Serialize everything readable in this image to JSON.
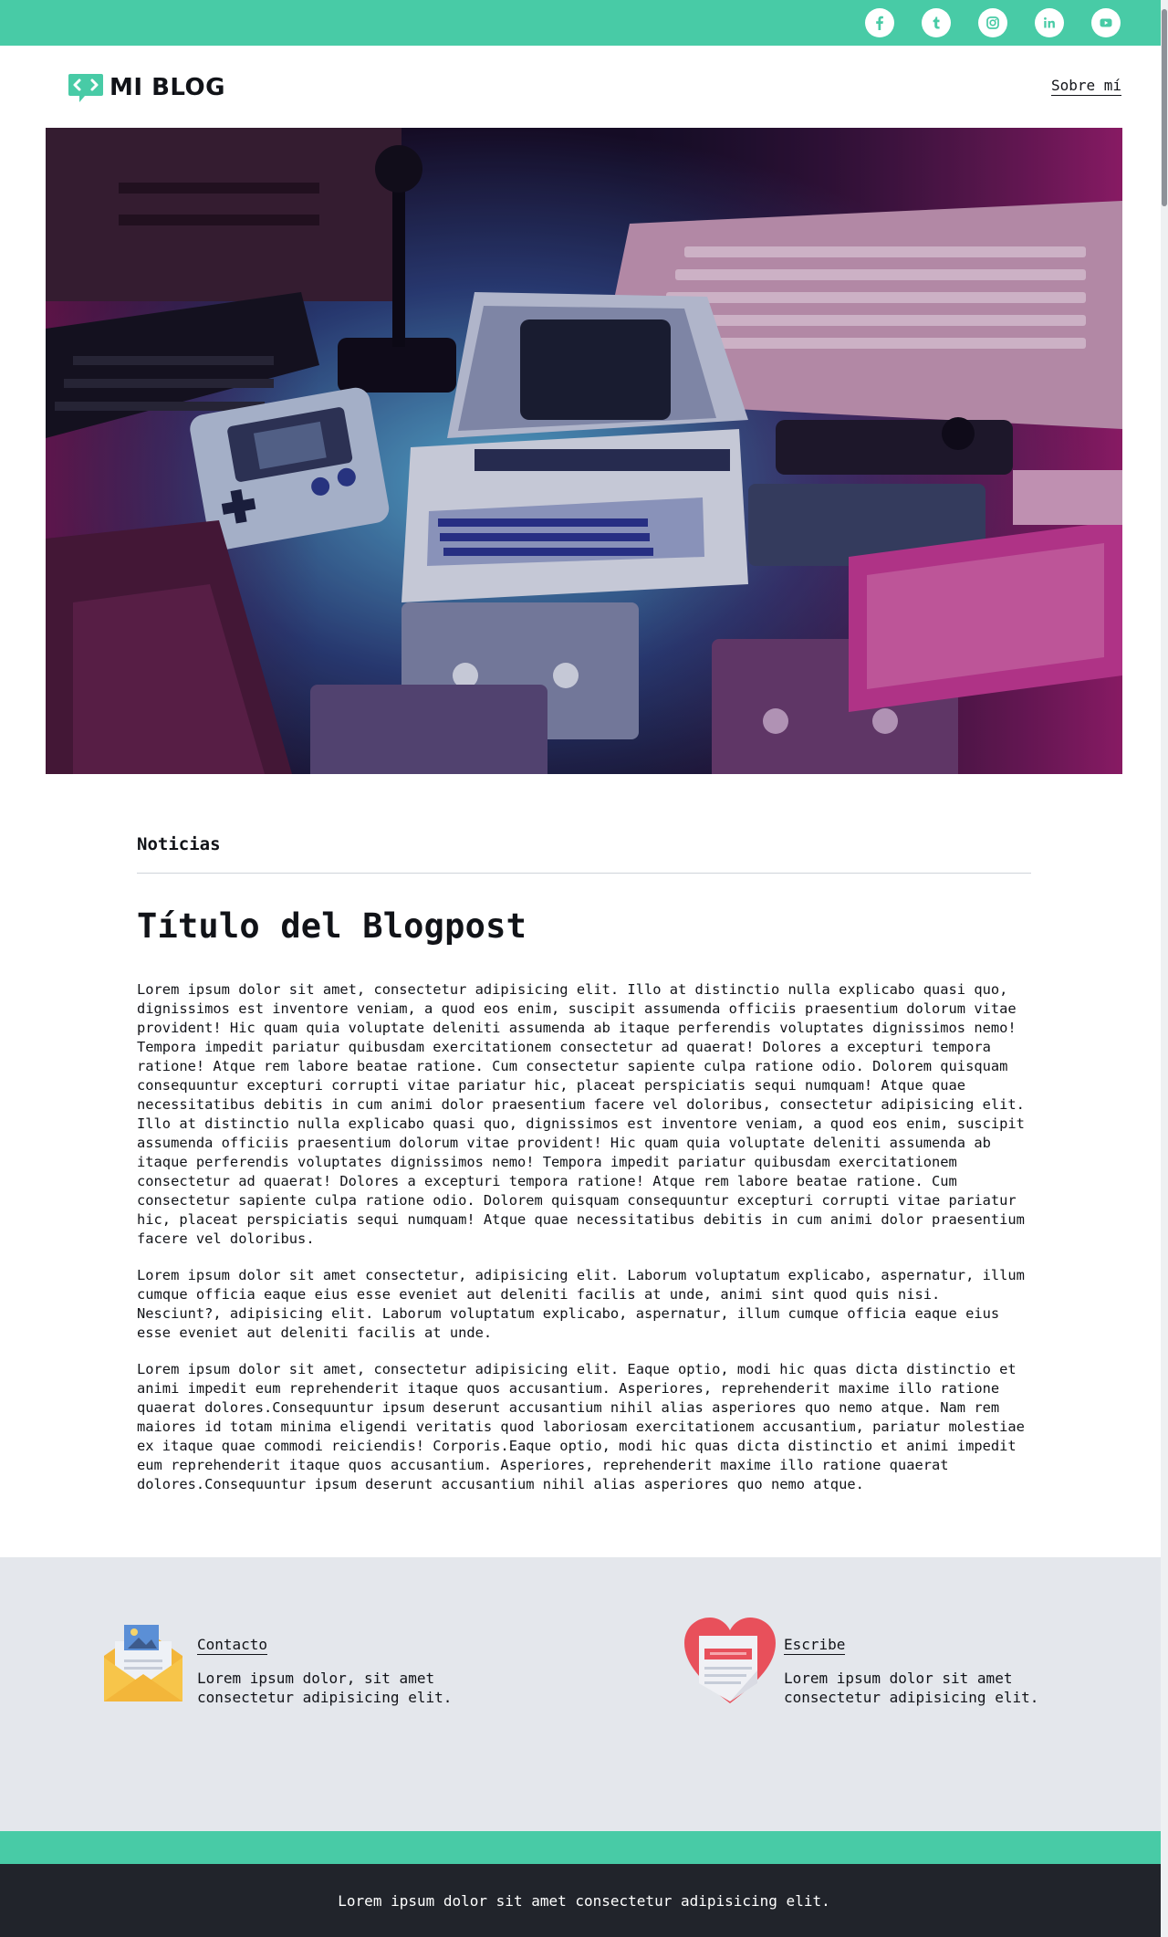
{
  "colors": {
    "accent": "#48cba6",
    "footer_bg": "#21242b",
    "features_bg": "#e4e7ec"
  },
  "social": [
    {
      "name": "facebook-icon"
    },
    {
      "name": "tumblr-icon"
    },
    {
      "name": "instagram-icon"
    },
    {
      "name": "linkedin-icon"
    },
    {
      "name": "youtube-icon"
    }
  ],
  "header": {
    "logo_text": "MI BLOG",
    "nav_about": "Sobre mí"
  },
  "hero": {
    "image": "retro-computers-photo"
  },
  "article": {
    "category": "Noticias",
    "title": "Título del Blogpost",
    "paragraphs": [
      "Lorem ipsum dolor sit amet, consectetur adipisicing elit. Illo at distinctio nulla explicabo quasi quo, dignissimos est inventore veniam, a quod eos enim, suscipit assumenda officiis praesentium dolorum vitae provident! Hic quam quia voluptate deleniti assumenda ab itaque perferendis voluptates dignissimos nemo! Tempora impedit pariatur quibusdam exercitationem consectetur ad quaerat! Dolores a excepturi tempora ratione! Atque rem labore beatae ratione. Cum consectetur sapiente culpa ratione odio. Dolorem quisquam consequuntur excepturi corrupti vitae pariatur hic, placeat perspiciatis sequi numquam! Atque quae necessitatibus debitis in cum animi dolor praesentium facere vel doloribus, consectetur adipisicing elit. Illo at distinctio nulla explicabo quasi quo, dignissimos est inventore veniam, a quod eos enim, suscipit assumenda officiis praesentium dolorum vitae provident! Hic quam quia voluptate deleniti assumenda ab itaque perferendis voluptates dignissimos nemo! Tempora impedit pariatur quibusdam exercitationem consectetur ad quaerat! Dolores a excepturi tempora ratione! Atque rem labore beatae ratione. Cum consectetur sapiente culpa ratione odio. Dolorem quisquam consequuntur excepturi corrupti vitae pariatur hic, placeat perspiciatis sequi numquam! Atque quae necessitatibus debitis in cum animi dolor praesentium facere vel doloribus.",
      "Lorem ipsum dolor sit amet consectetur, adipisicing elit. Laborum voluptatum explicabo, aspernatur, illum cumque officia eaque eius esse eveniet aut deleniti facilis at unde, animi sint quod quis nisi. Nesciunt?, adipisicing elit. Laborum voluptatum explicabo, aspernatur, illum cumque officia eaque eius esse eveniet aut deleniti facilis at unde.",
      "Lorem ipsum dolor sit amet, consectetur adipisicing elit. Eaque optio, modi hic quas dicta distinctio et animi impedit eum reprehenderit itaque quos accusantium. Asperiores, reprehenderit maxime illo ratione quaerat dolores.Consequuntur ipsum deserunt accusantium nihil alias asperiores quo nemo atque. Nam rem maiores id totam minima eligendi veritatis quod laboriosam exercitationem accusantium, pariatur molestiae ex itaque quae commodi reiciendis! Corporis.Eaque optio, modi hic quas dicta distinctio et animi impedit eum reprehenderit itaque quos accusantium. Asperiores, reprehenderit maxime illo ratione quaerat dolores.Consequuntur ipsum deserunt accusantium nihil alias asperiores quo nemo atque."
    ]
  },
  "features": {
    "contact": {
      "title": "Contacto",
      "text": "Lorem ipsum dolor, sit amet consectetur adipisicing elit.",
      "icon": "envelope-icon"
    },
    "write": {
      "title": "Escribe",
      "text": "Lorem ipsum dolor sit amet consectetur adipisicing elit.",
      "icon": "heart-document-icon"
    }
  },
  "footer": {
    "text": "Lorem ipsum dolor sit amet consectetur adipisicing elit."
  }
}
